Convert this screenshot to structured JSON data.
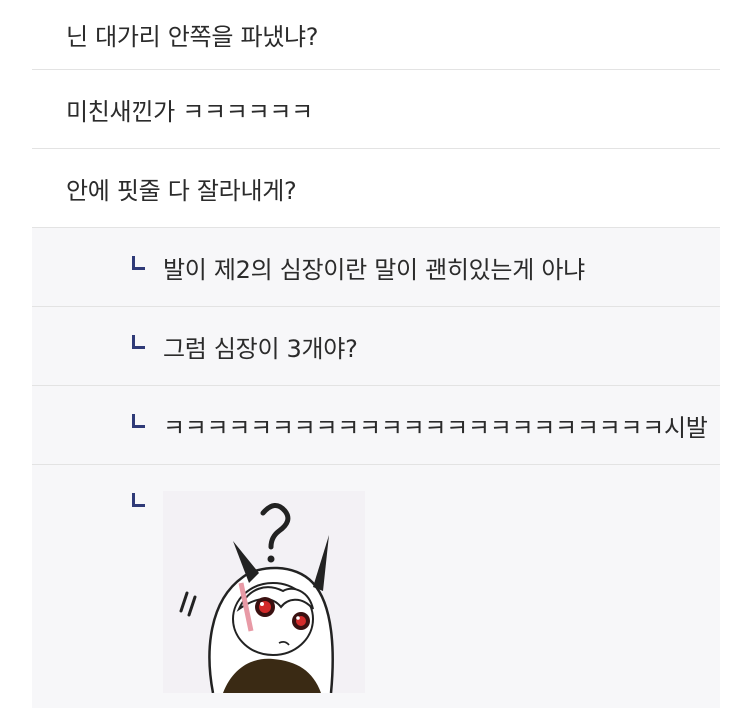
{
  "comments": [
    {
      "text": "닌 대가리 안쪽을 파냈냐?"
    },
    {
      "text": "미친새낀가 ㅋㅋㅋㅋㅋㅋ"
    },
    {
      "text": "안에 핏줄 다 잘라내게?"
    }
  ],
  "replies": [
    {
      "text": "발이 제2의 심장이란 말이 괜히있는게 아냐"
    },
    {
      "text": "그럼 심장이 3개야?"
    },
    {
      "text": "ㅋㅋㅋㅋㅋㅋㅋㅋㅋㅋㅋㅋㅋㅋㅋㅋㅋㅋㅋㅋㅋㅋㅋ시발"
    }
  ],
  "sticker": {
    "description_icon": "confused-anime-girl-sticker"
  },
  "colors": {
    "reply_arrow": "#2f3a78",
    "reply_bg": "#f7f7f9",
    "divider": "#e3e3e3"
  }
}
